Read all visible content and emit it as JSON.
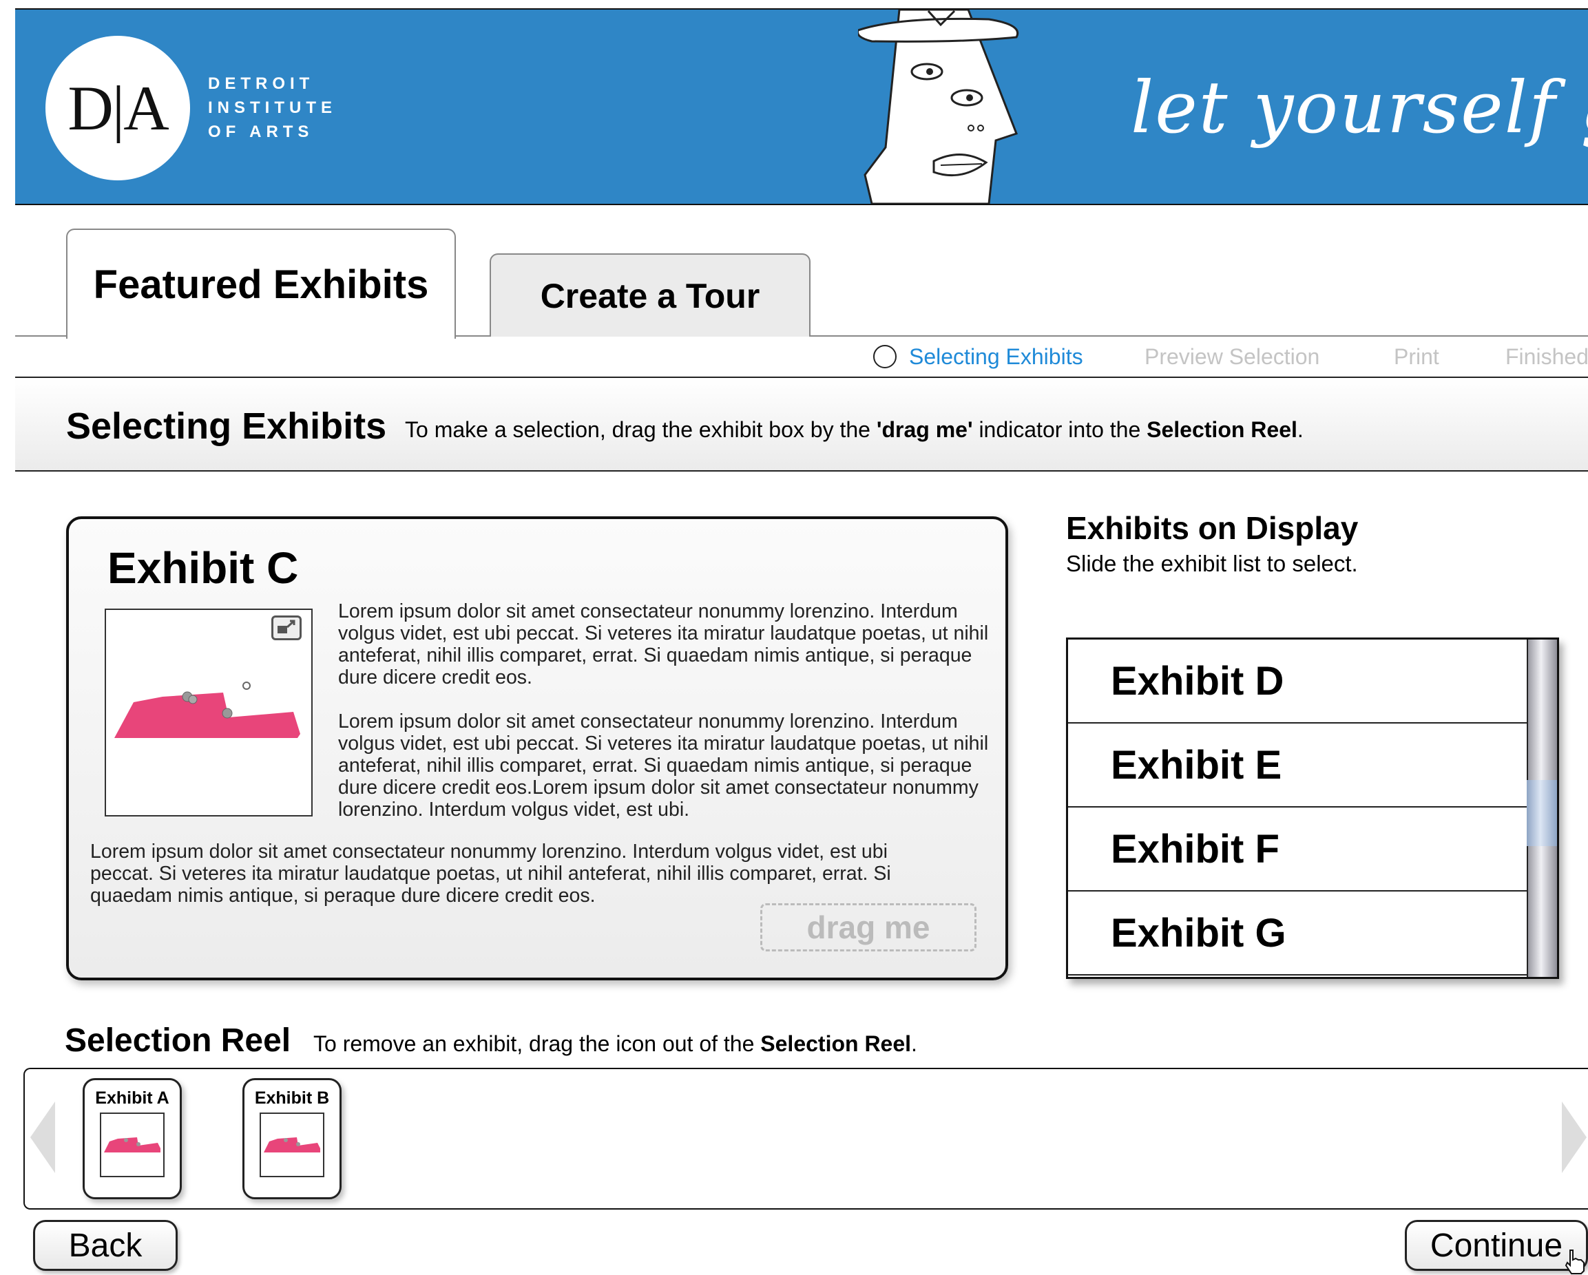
{
  "header": {
    "logo_mark": "D|A",
    "logo_lines": [
      "DETROIT",
      "INSTITUTE",
      "OF ARTS"
    ],
    "tagline": "let yourself go"
  },
  "tabs": [
    {
      "label": "Featured Exhibits",
      "active": true
    },
    {
      "label": "Create a Tour",
      "active": false
    }
  ],
  "steps": [
    {
      "label": "Selecting Exhibits",
      "current": true
    },
    {
      "label": "Preview Selection",
      "current": false
    },
    {
      "label": "Print",
      "current": false
    },
    {
      "label": "Finished",
      "current": false
    }
  ],
  "instructions": {
    "title": "Selecting Exhibits",
    "text_1": "To make a selection, drag the exhibit box by the ",
    "text_bold_1": "'drag me'",
    "text_2": " indicator into the ",
    "text_bold_2": "Selection Reel",
    "text_3": "."
  },
  "exhibit": {
    "title": "Exhibit C",
    "paragraphs": [
      "Lorem ipsum dolor sit amet consectateur nonummy lorenzino. Interdum volgus videt, est ubi peccat. Si veteres ita miratur laudatque poetas, ut nihil anteferat, nihil illis comparet, errat. Si quaedam nimis antique, si peraque dure dicere credit eos.",
      "Lorem ipsum dolor sit amet consectateur nonummy lorenzino. Interdum volgus videt, est ubi peccat. Si veteres ita miratur laudatque poetas, ut nihil anteferat, nihil illis comparet, errat. Si quaedam nimis antique, si peraque dure dicere credit eos.Lorem ipsum dolor sit amet consectateur nonummy lorenzino. Interdum volgus videt, est ubi.",
      "Lorem ipsum dolor sit amet consectateur nonummy lorenzino. Interdum volgus videt, est ubi peccat. Si veteres ita miratur laudatque poetas, ut nihil anteferat, nihil illis comparet, errat. Si quaedam nimis antique, si peraque dure dicere credit eos."
    ],
    "drag_label": "drag me",
    "image_color": "#e8457a"
  },
  "display": {
    "title": "Exhibits on Display",
    "subtitle": "Slide the exhibit list to select.",
    "items": [
      "Exhibit D",
      "Exhibit E",
      "Exhibit F",
      "Exhibit G"
    ]
  },
  "reel": {
    "title": "Selection Reel",
    "text_1": "To remove an exhibit, drag the icon out of the ",
    "text_bold": "Selection Reel",
    "text_2": ".",
    "items": [
      "Exhibit A",
      "Exhibit B"
    ]
  },
  "buttons": {
    "back": "Back",
    "continue": "Continue"
  },
  "colors": {
    "banner": "#2f86c6",
    "active_step": "#1f8ad8",
    "inactive_step": "#c4c4c4",
    "accent_pink": "#e8457a"
  }
}
